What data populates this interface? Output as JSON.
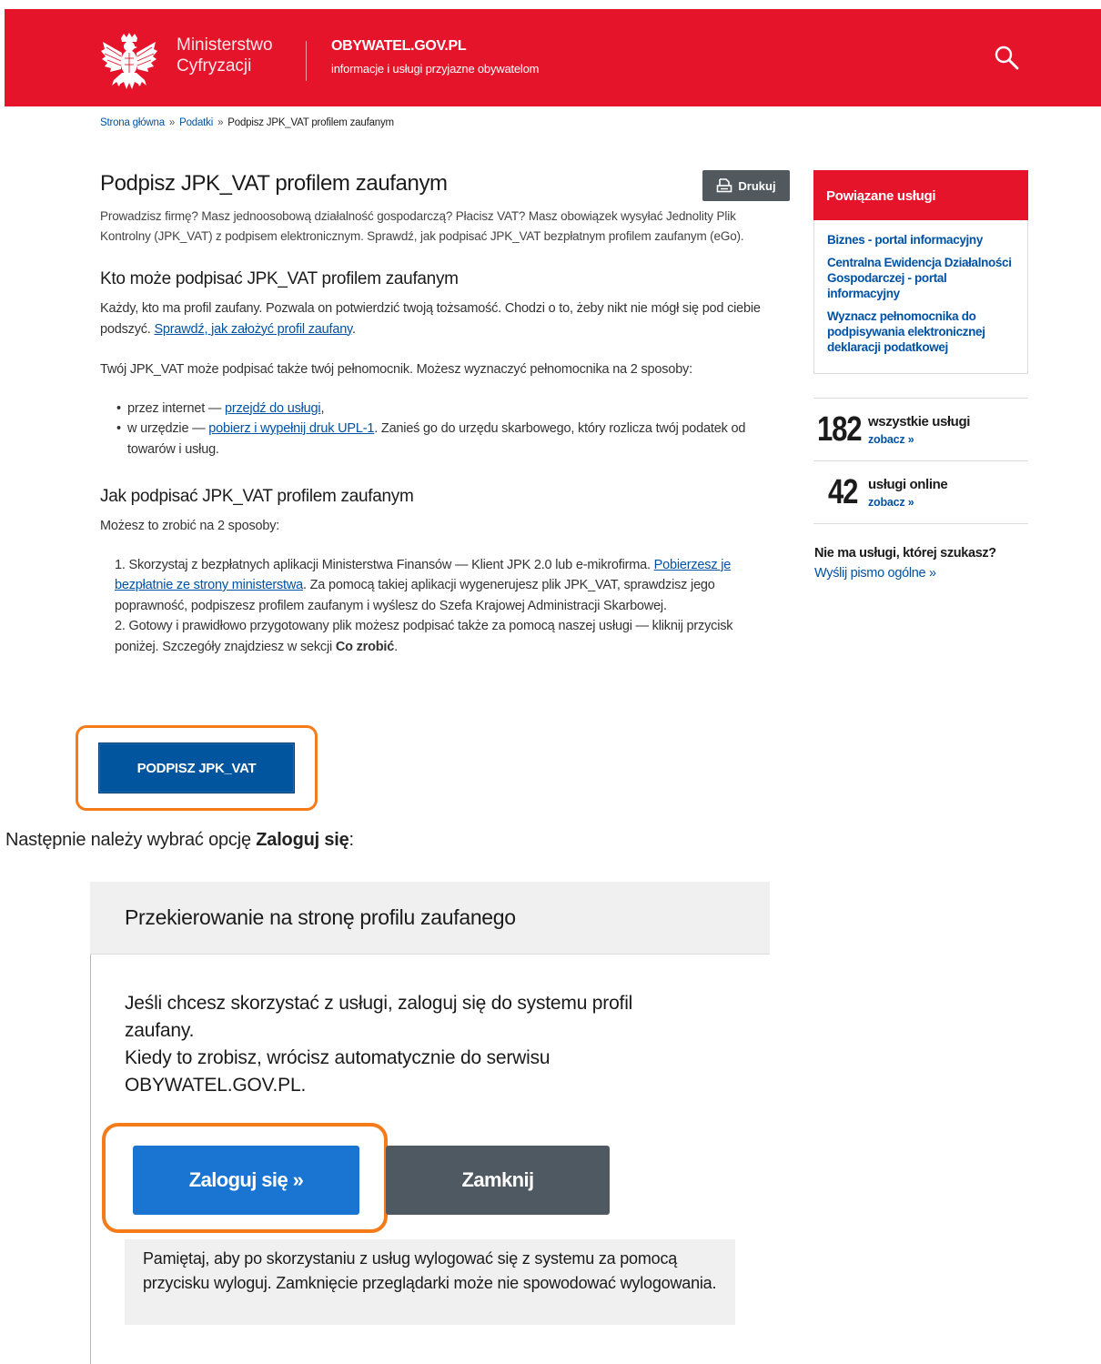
{
  "header": {
    "ministry_line1": "Ministerstwo",
    "ministry_line2": "Cyfryzacji",
    "site_name": "OBYWATEL.GOV.PL",
    "site_tagline": "informacje i usługi przyjazne obywatelom",
    "bg_color": "#e5142b"
  },
  "breadcrumb": {
    "items": [
      "Strona główna",
      "Podatki",
      "Podpisz JPK_VAT profilem zaufanym"
    ],
    "separator": "»"
  },
  "main": {
    "title": "Podpisz JPK_VAT profilem zaufanym",
    "print_label": "Drukuj",
    "intro": "Prowadzisz firmę? Masz jednoosobową działalność gospodarczą? Płacisz VAT? Masz obowiązek wysyłać Jednolity Plik Kontrolny (JPK_VAT) z podpisem elektronicznym. Sprawdź, jak podpisać JPK_VAT bezpłatnym profilem zaufanym (eGo).",
    "section1": {
      "heading": "Kto może podpisać JPK_VAT profilem zaufanym",
      "p1_text": "Każdy, kto ma profil zaufany. Pozwala on potwierdzić twoją tożsamość. Chodzi o to, żeby nikt nie mógł się pod ciebie podszyć. ",
      "p1_link": "Sprawdź, jak założyć profil zaufany",
      "p1_end": ".",
      "p2": "Twój JPK_VAT może podpisać także twój pełnomocnik. Możesz wyznaczyć pełnomocnika na 2 sposoby:",
      "bullet1_text": "przez internet — ",
      "bullet1_link": "przejdź do usługi",
      "bullet1_end": ",",
      "bullet2_text": "w urzędzie — ",
      "bullet2_link": "pobierz i wypełnij druk UPL-1",
      "bullet2_end": ". Zanieś go do urzędu skarbowego, który rozlicza twój podatek od towarów i usług."
    },
    "section2": {
      "heading": "Jak podpisać JPK_VAT profilem zaufanym",
      "p1": "Możesz to zrobić na 2 sposoby:",
      "item1_text": "1. Skorzystaj z bezpłatnych aplikacji Ministerstwa Finansów — Klient JPK 2.0 lub e-mikrofirma. ",
      "item1_link": "Pobierzesz je bezpłatnie ze strony ministerstwa",
      "item1_end": ". Za pomocą takiej aplikacji wygenerujesz plik JPK_VAT, sprawdzisz jego poprawność, podpiszesz profilem zaufanym i wyślesz do Szefa Krajowej Administracji Skarbowej.",
      "item2_text": "2. Gotowy i prawidłowo przygotowany plik możesz podpisać także za pomocą naszej usługi — kliknij przycisk poniżej. Szczegóły znajdziesz w sekcji ",
      "item2_bold": "Co zrobić",
      "item2_end": "."
    },
    "sign_button": "PODPISZ JPK_VAT"
  },
  "sidebar": {
    "related_title": "Powiązane usługi",
    "related_items": [
      "Biznes - portal informacyjny",
      "Centralna Ewidencja Działalności Gospodarczej - portal informacyjny",
      "Wyznacz pełnomocnika do podpisywania elektronicznej deklaracji podatkowej"
    ],
    "all_services_count": "182",
    "all_services_label": "wszystkie usługi",
    "online_services_count": "42",
    "online_services_label": "usługi online",
    "see_link": "zobacz »",
    "missing_question": "Nie ma usługi, której szukasz?",
    "missing_link": "Wyślij pismo ogólne »"
  },
  "caption": {
    "text": "Następnie należy wybrać opcję ",
    "bold": "Zaloguj się",
    "end": ":"
  },
  "redirect_panel": {
    "title": "Przekierowanie na stronę profilu zaufanego",
    "text_line1": "Jeśli chcesz skorzystać z usługi, zaloguj się do systemu profil zaufany.",
    "text_line2": "Kiedy to zrobisz, wrócisz automatycznie do serwisu OBYWATEL.GOV.PL.",
    "login_button": "Zaloguj się »",
    "close_button": "Zamknij",
    "note": "Pamiętaj, aby po skorzystaniu z usług wylogować się z systemu za pomocą przycisku wyloguj. Zamknięcie przeglądarki może nie spowodować wylogowania."
  },
  "colors": {
    "accent_red": "#e5142b",
    "link_blue": "#0052a5",
    "primary_button": "#00559e",
    "login_button": "#1a74d2",
    "secondary_button": "#4f5962",
    "highlight_orange": "#f57a18"
  },
  "icons": {
    "logo": "polish-eagle-icon",
    "search": "search-icon",
    "print": "printer-icon"
  }
}
